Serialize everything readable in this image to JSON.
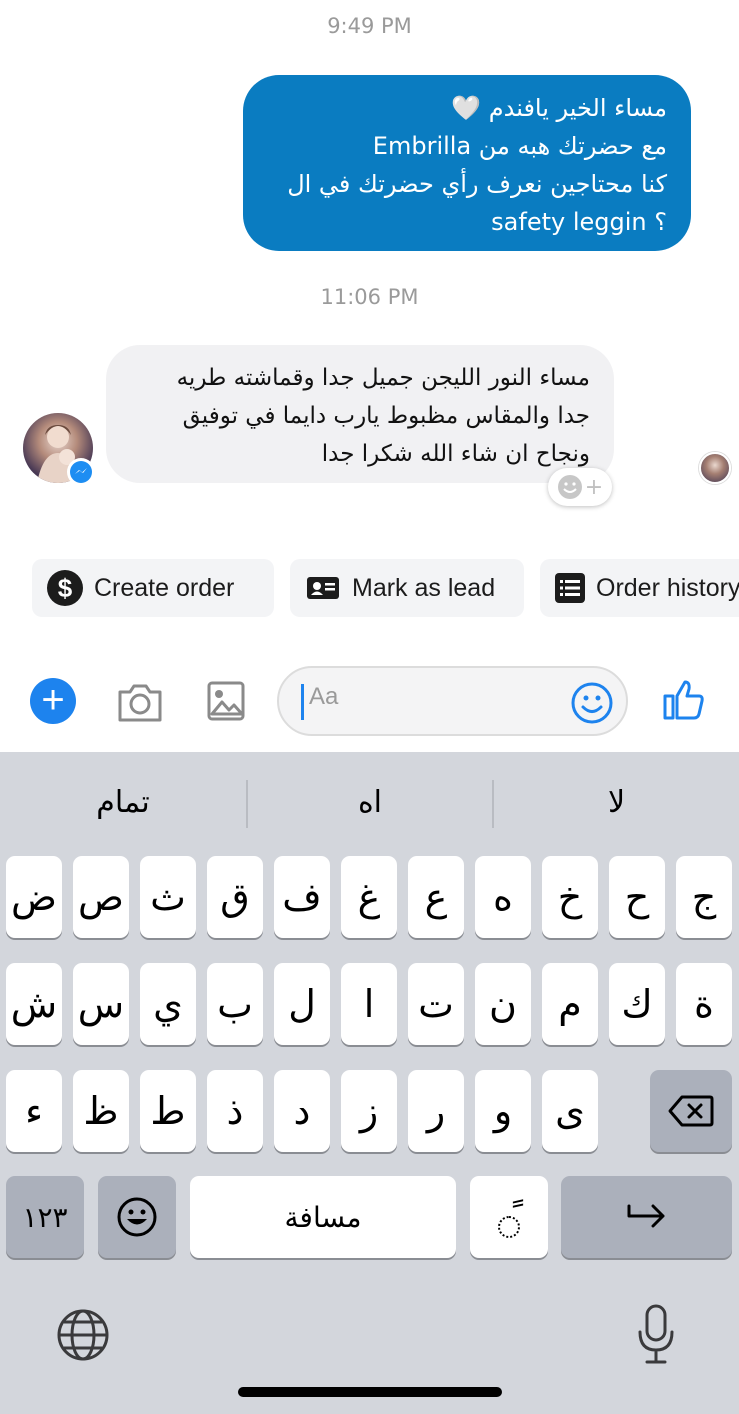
{
  "timestamps": {
    "first": "9:49 PM",
    "second": "11:06 PM"
  },
  "outgoing_message": {
    "lines": [
      "مساء الخير يافندم 🤍",
      "مع حضرتك هبه من Embrilla",
      "كنا محتاجين نعرف رأي حضرتك في ال",
      "safety leggin ؟"
    ]
  },
  "incoming_message": {
    "lines": [
      "مساء النور الليجن جميل جدا وقماشته طريه",
      "جدا والمقاس مظبوط يارب دايما في توفيق",
      "ونجاح ان شاء الله شكرا جدا"
    ]
  },
  "quick_actions": [
    {
      "label": "Create order",
      "icon": "dollar-icon"
    },
    {
      "label": "Mark as lead",
      "icon": "id-card-icon"
    },
    {
      "label": "Order history",
      "icon": "list-icon"
    }
  ],
  "composer": {
    "placeholder": "Aa"
  },
  "keyboard": {
    "suggestions": [
      "تمام",
      "اه",
      "لا"
    ],
    "row1": [
      "ض",
      "ص",
      "ث",
      "ق",
      "ف",
      "غ",
      "ع",
      "ه",
      "خ",
      "ح",
      "ج"
    ],
    "row2": [
      "ش",
      "س",
      "ي",
      "ب",
      "ل",
      "ا",
      "ت",
      "ن",
      "م",
      "ك",
      "ة"
    ],
    "row3": [
      "ء",
      "ظ",
      "ط",
      "ذ",
      "د",
      "ز",
      "ر",
      "و",
      "ى"
    ],
    "numbers_label": "١٢٣",
    "space_label": "مسافة",
    "diacritic_label": "ً"
  },
  "colors": {
    "outgoing_bubble": "#0a7cc1",
    "accent": "#1d83ee",
    "incoming_bubble": "#f1f1f3"
  }
}
